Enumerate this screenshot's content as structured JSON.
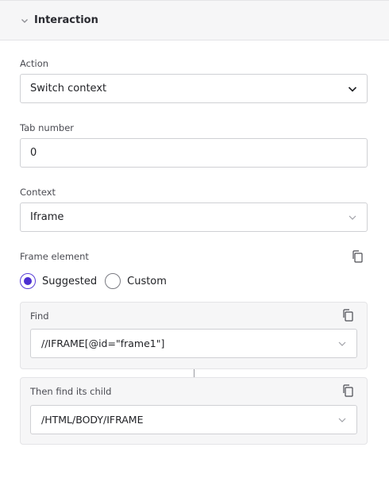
{
  "section": {
    "title": "Interaction"
  },
  "action": {
    "label": "Action",
    "value": "Switch context"
  },
  "tab_number": {
    "label": "Tab number",
    "value": "0"
  },
  "context": {
    "label": "Context",
    "value": "Iframe"
  },
  "frame_element": {
    "label": "Frame element",
    "options": [
      {
        "label": "Suggested",
        "checked": true
      },
      {
        "label": "Custom",
        "checked": false
      }
    ]
  },
  "find": {
    "label": "Find",
    "value": "//IFRAME[@id=\"frame1\"]"
  },
  "child": {
    "label": "Then find its child",
    "value": "/HTML/BODY/IFRAME"
  },
  "colors": {
    "accent": "#4b2fd1",
    "panel_bg": "#f6f6f7",
    "border": "#cfd0d4"
  },
  "icons": [
    "chevron-down-icon",
    "copy-icon"
  ]
}
